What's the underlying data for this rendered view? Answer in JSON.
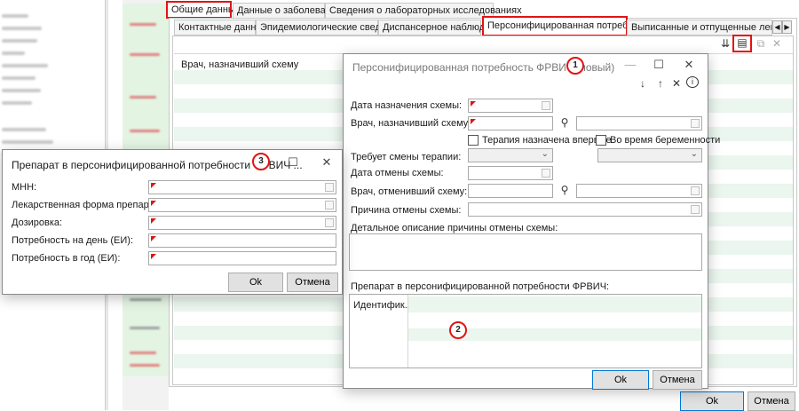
{
  "tabs_top": [
    {
      "label": "Общие данные",
      "active": true
    },
    {
      "label": "Данные о заболевании"
    },
    {
      "label": "Сведения о лабораторных исследованиях"
    }
  ],
  "tabs_sub": [
    {
      "label": "Контактные данные"
    },
    {
      "label": "Эпидемиологические сведения"
    },
    {
      "label": "Диспансерное наблюдение"
    },
    {
      "label": "Персонифицированная потребность",
      "active": true
    },
    {
      "label": "Выписанные и отпущенные лекарствен"
    }
  ],
  "grid_header": "Врач, назначивший схему",
  "main_buttons": {
    "ok": "Ok",
    "cancel": "Отмена"
  },
  "dialog1": {
    "title": "Персонифицированная потребность ФРВИЧ (новый)",
    "fields": {
      "date_assigned": "Дата назначения схемы:",
      "doctor_assigned": "Врач, назначивший схему:",
      "therapy_first": "Терапия назначена впервые",
      "pregnancy": "Во время беременности",
      "requires_change": "Требует смены терапии:",
      "date_cancel": "Дата отмены схемы:",
      "doctor_cancel": "Врач, отменивший схему:",
      "reason_cancel": "Причина отмены схемы:",
      "reason_detail": "Детальное описание причины отмены схемы:",
      "drug_section": "Препарат в персонифицированной потребности ФРВИЧ:",
      "grid_col": "Идентифик..."
    },
    "buttons": {
      "ok": "Ok",
      "cancel": "Отмена"
    }
  },
  "dialog3": {
    "title": "Препарат в персонифицированной потребности ФРВИЧ ...",
    "fields": {
      "mnn": "МНН:",
      "form": "Лекарственная форма препарата:",
      "dose": "Дозировка:",
      "per_day": "Потребность на день (ЕИ):",
      "per_year": "Потребность в год (ЕИ):"
    },
    "buttons": {
      "ok": "Ok",
      "cancel": "Отмена"
    }
  },
  "callouts": [
    "1",
    "2",
    "3"
  ],
  "colors": {
    "highlight_red": "#e01414",
    "row_green": "#eaf6ee"
  },
  "icons": [
    "sort-icon",
    "edit-icon",
    "preview-icon",
    "close-icon",
    "arrow-down-icon",
    "arrow-up-icon",
    "info-icon",
    "search-icon",
    "minimize-icon",
    "maximize-icon",
    "chevron-left-icon",
    "chevron-right-icon"
  ]
}
